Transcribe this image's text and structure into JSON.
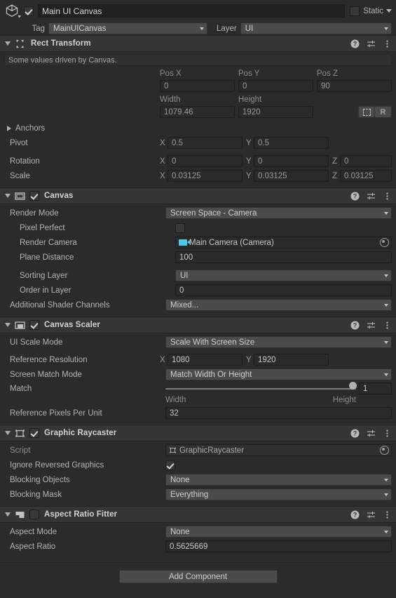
{
  "gameobject": {
    "icon": "cube-icon",
    "active": true,
    "name": "Main UI Canvas",
    "static_label": "Static",
    "static_checked": false,
    "tag_label": "Tag",
    "tag_value": "MainUICanvas",
    "layer_label": "Layer",
    "layer_value": "UI"
  },
  "components": [
    {
      "id": "rect-transform",
      "title": "Rect Transform",
      "icon": "rect-transform-icon",
      "has_checkbox": false,
      "expanded": true,
      "info": "Some values driven by Canvas.",
      "pos_headers": [
        "Pos X",
        "Pos Y",
        "Pos Z"
      ],
      "pos_values": [
        "0",
        "0",
        "90"
      ],
      "size_headers": [
        "Width",
        "Height"
      ],
      "size_values": [
        "1079.46",
        "1920"
      ],
      "blueprint_button": "blueprint-mode-icon",
      "raw_button": "R",
      "anchors_label": "Anchors",
      "pivot_label": "Pivot",
      "pivot": {
        "x_axis": "X",
        "x": "0.5",
        "y_axis": "Y",
        "y": "0.5"
      },
      "rotation_label": "Rotation",
      "rotation": {
        "x_axis": "X",
        "x": "0",
        "y_axis": "Y",
        "y": "0",
        "z_axis": "Z",
        "z": "0"
      },
      "scale_label": "Scale",
      "scale": {
        "x_axis": "X",
        "x": "0.03125",
        "y_axis": "Y",
        "y": "0.03125",
        "z_axis": "Z",
        "z": "0.03125"
      }
    },
    {
      "id": "canvas",
      "title": "Canvas",
      "icon": "canvas-icon",
      "has_checkbox": true,
      "checked": true,
      "expanded": true,
      "rows": {
        "render_mode_label": "Render Mode",
        "render_mode_value": "Screen Space - Camera",
        "pixel_perfect_label": "Pixel Perfect",
        "pixel_perfect_checked": false,
        "render_camera_label": "Render Camera",
        "render_camera_value": "Main Camera (Camera)",
        "plane_distance_label": "Plane Distance",
        "plane_distance_value": "100",
        "sorting_layer_label": "Sorting Layer",
        "sorting_layer_value": "UI",
        "order_in_layer_label": "Order in Layer",
        "order_in_layer_value": "0",
        "shader_channels_label": "Additional Shader Channels",
        "shader_channels_value": "Mixed..."
      }
    },
    {
      "id": "canvas-scaler",
      "title": "Canvas Scaler",
      "icon": "canvas-scaler-icon",
      "has_checkbox": true,
      "checked": true,
      "expanded": true,
      "rows": {
        "ui_scale_mode_label": "UI Scale Mode",
        "ui_scale_mode_value": "Scale With Screen Size",
        "reference_resolution_label": "Reference Resolution",
        "ref_x_axis": "X",
        "ref_x": "1080",
        "ref_y_axis": "Y",
        "ref_y": "1920",
        "screen_match_mode_label": "Screen Match Mode",
        "screen_match_mode_value": "Match Width Or Height",
        "match_label": "Match",
        "match_value": "1",
        "match_min_label": "Width",
        "match_max_label": "Height",
        "reference_ppu_label": "Reference Pixels Per Unit",
        "reference_ppu_value": "32"
      }
    },
    {
      "id": "graphic-raycaster",
      "title": "Graphic Raycaster",
      "icon": "graphic-raycaster-icon",
      "has_checkbox": true,
      "checked": true,
      "expanded": true,
      "rows": {
        "script_label": "Script",
        "script_value": "GraphicRaycaster",
        "ignore_reversed_label": "Ignore Reversed Graphics",
        "ignore_reversed_checked": true,
        "blocking_objects_label": "Blocking Objects",
        "blocking_objects_value": "None",
        "blocking_mask_label": "Blocking Mask",
        "blocking_mask_value": "Everything"
      }
    },
    {
      "id": "aspect-ratio-fitter",
      "title": "Aspect Ratio Fitter",
      "icon": "aspect-ratio-fitter-icon",
      "has_checkbox": true,
      "checked": false,
      "expanded": true,
      "rows": {
        "aspect_mode_label": "Aspect Mode",
        "aspect_mode_value": "None",
        "aspect_ratio_label": "Aspect Ratio",
        "aspect_ratio_value": "0.5625669"
      }
    }
  ],
  "header_icons": {
    "help": "help-icon",
    "preset": "preset-icon",
    "menu": "kebab-menu-icon"
  },
  "add_component_label": "Add Component",
  "colors": {
    "background": "#2b2b2b",
    "component_header": "#353535",
    "field": "#2a2a2a",
    "dropdown": "#4b4b4b",
    "text": "#b4b4b4",
    "camera_accent": "#4ec9e8"
  }
}
